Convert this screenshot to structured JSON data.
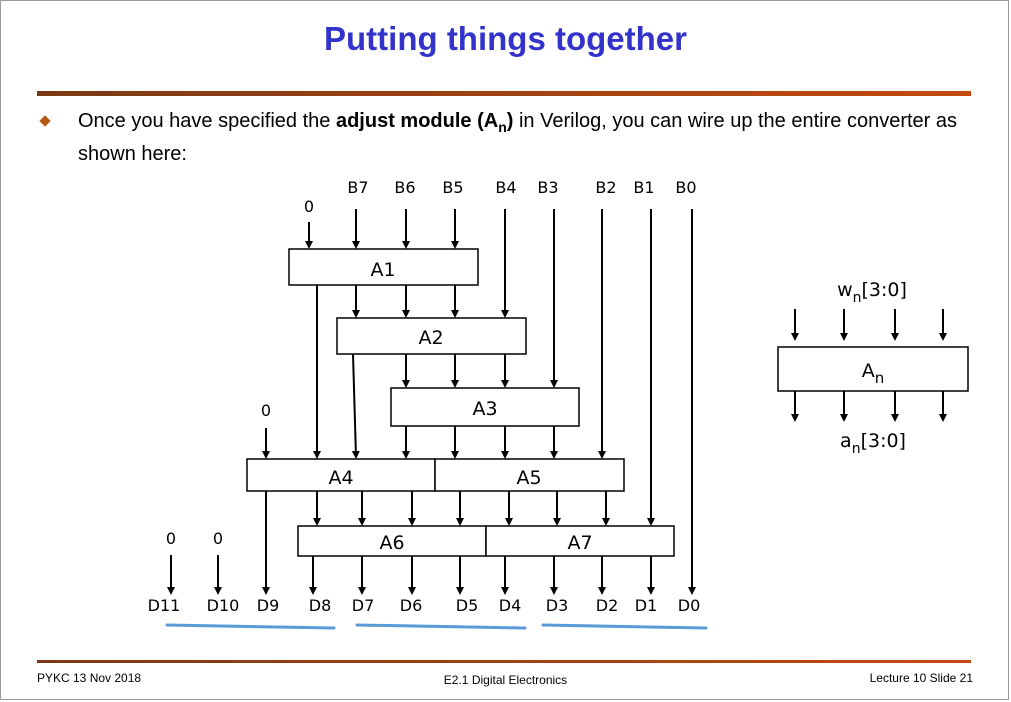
{
  "slide": {
    "title": "Putting things together",
    "bullet": {
      "before": "Once you have specified the ",
      "bold": "adjust module (A",
      "bold_sub": "n",
      "bold_after": ")",
      "after": " in Verilog, you can wire up the entire converter as shown here:"
    }
  },
  "diagram": {
    "inputs": {
      "zero_a1": "0",
      "b7": "B7",
      "b6": "B6",
      "b5": "B5",
      "b4": "B4",
      "b3": "B3",
      "b2": "B2",
      "b1": "B1",
      "b0": "B0",
      "zero_a4": "0",
      "zero_d11": "0",
      "zero_d10": "0"
    },
    "blocks": {
      "a1": "A1",
      "a2": "A2",
      "a3": "A3",
      "a4": "A4",
      "a5": "A5",
      "a6": "A6",
      "a7": "A7"
    },
    "outputs": {
      "d11": "D11",
      "d10": "D10",
      "d9": "D9",
      "d8": "D8",
      "d7": "D7",
      "d6": "D6",
      "d5": "D5",
      "d4": "D4",
      "d3": "D3",
      "d2": "D2",
      "d1": "D1",
      "d0": "D0"
    },
    "module": {
      "input_base": "w",
      "input_sub": "n",
      "input_range": "[3:0]",
      "block_base": "A",
      "block_sub": "n",
      "output_base": "a",
      "output_sub": "n",
      "output_range": "[3:0]"
    },
    "colors": {
      "group_underline": "#5b9bd5",
      "title": "#3333cc",
      "accent": "#c44a10"
    }
  },
  "footer": {
    "left": "PYKC 13 Nov 2018",
    "center": "E2.1 Digital Electronics",
    "right": "Lecture 10 Slide 21"
  }
}
